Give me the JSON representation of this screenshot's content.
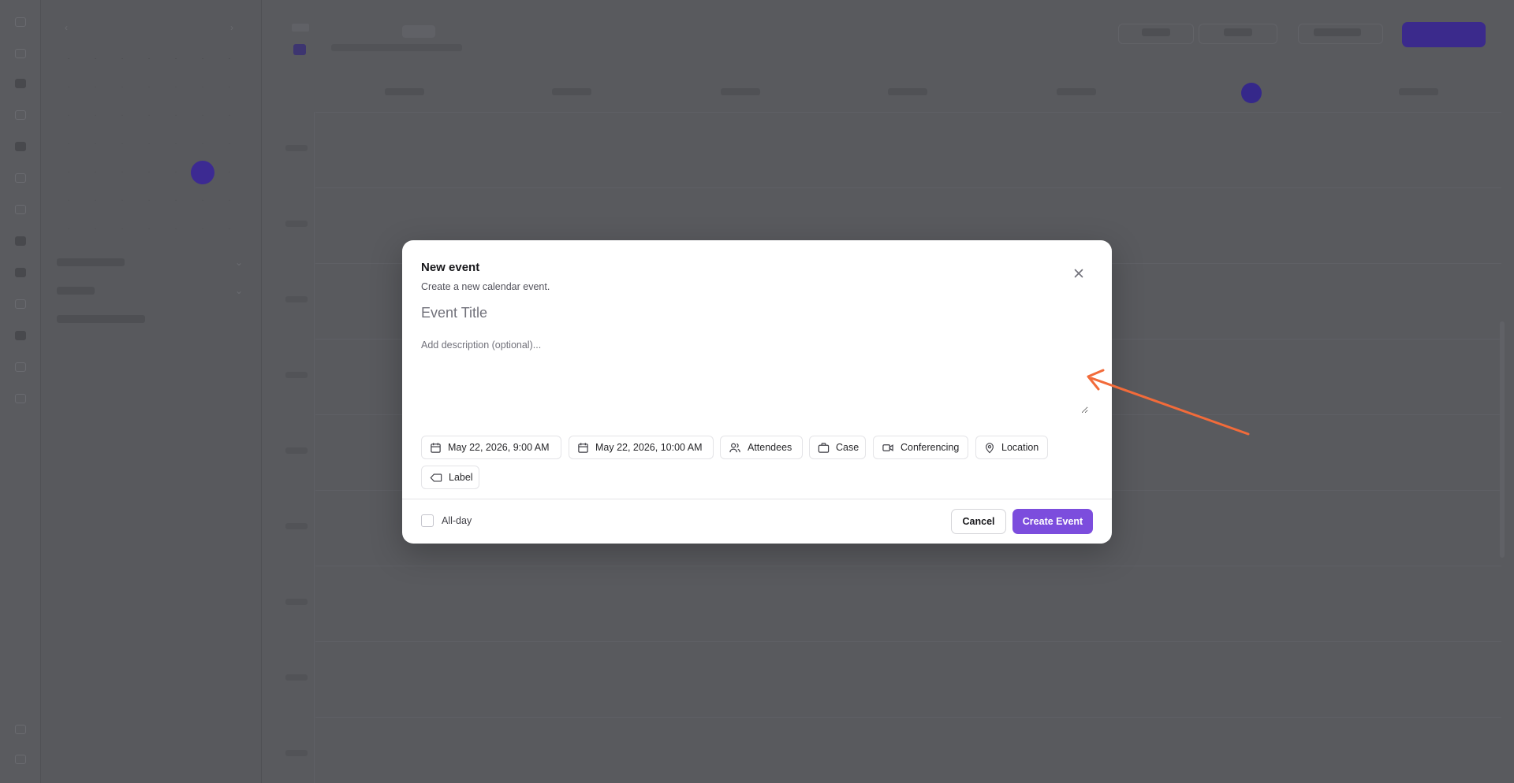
{
  "modal": {
    "title": "New event",
    "subtitle": "Create a new calendar event.",
    "title_placeholder": "Event Title",
    "description_placeholder": "Add description (optional)...",
    "chips": {
      "start": "May 22, 2026, 9:00 AM",
      "end": "May 22, 2026, 10:00 AM",
      "attendees": "Attendees",
      "case": "Case",
      "conferencing": "Conferencing",
      "location": "Location",
      "label": "Label"
    },
    "allday_label": "All-day",
    "cancel_label": "Cancel",
    "create_label": "Create Event"
  },
  "colors": {
    "primary": "#7c4ddd",
    "overlay": "#595a5e",
    "annotation": "#f26b3a"
  },
  "icons": {
    "close": "close-icon",
    "calendar": "calendar-icon",
    "attendees": "users-icon",
    "case": "briefcase-icon",
    "conferencing": "video-icon",
    "location": "map-pin-icon",
    "label": "tag-icon"
  }
}
